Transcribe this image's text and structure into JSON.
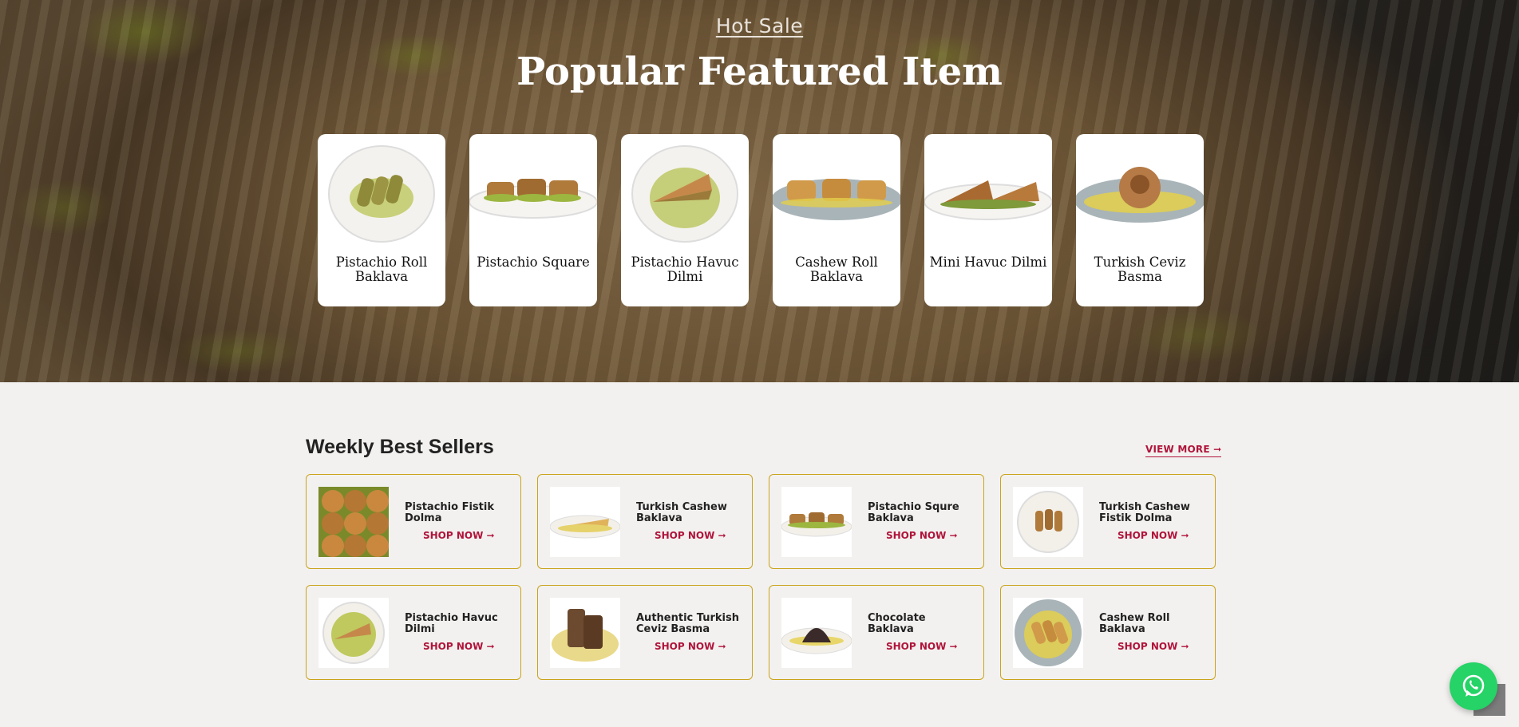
{
  "hero": {
    "kicker": "Hot Sale",
    "title": "Popular Featured Item",
    "items": [
      {
        "name": "Pistachio Roll Baklava",
        "icon": "pistachio-roll-plate"
      },
      {
        "name": "Pistachio Square",
        "icon": "pistachio-square-plate"
      },
      {
        "name": "Pistachio Havuc Dilmi",
        "icon": "pistachio-havuc-plate"
      },
      {
        "name": "Cashew Roll Baklava",
        "icon": "cashew-roll-plate"
      },
      {
        "name": "Mini Havuc Dilmi",
        "icon": "mini-havuc-plate"
      },
      {
        "name": "Turkish Ceviz Basma",
        "icon": "ceviz-basma-plate"
      }
    ]
  },
  "best_sellers": {
    "title": "Weekly Best Sellers",
    "view_more": "VIEW MORE ➞",
    "shop_now": "SHOP NOW ➞",
    "products": [
      {
        "name": "Pistachio Fistik Dolma"
      },
      {
        "name": "Turkish Cashew Baklava"
      },
      {
        "name": "Pistachio Squre Baklava"
      },
      {
        "name": "Turkish Cashew Fistik Dolma"
      },
      {
        "name": "Pistachio Havuc Dilmi"
      },
      {
        "name": "Authentic Turkish Ceviz Basma"
      },
      {
        "name": "Chocolate Baklava"
      },
      {
        "name": "Cashew Roll Baklava"
      }
    ]
  },
  "colors": {
    "accent": "#b0143a",
    "card_border": "#c9a41b",
    "whatsapp": "#25d366"
  }
}
